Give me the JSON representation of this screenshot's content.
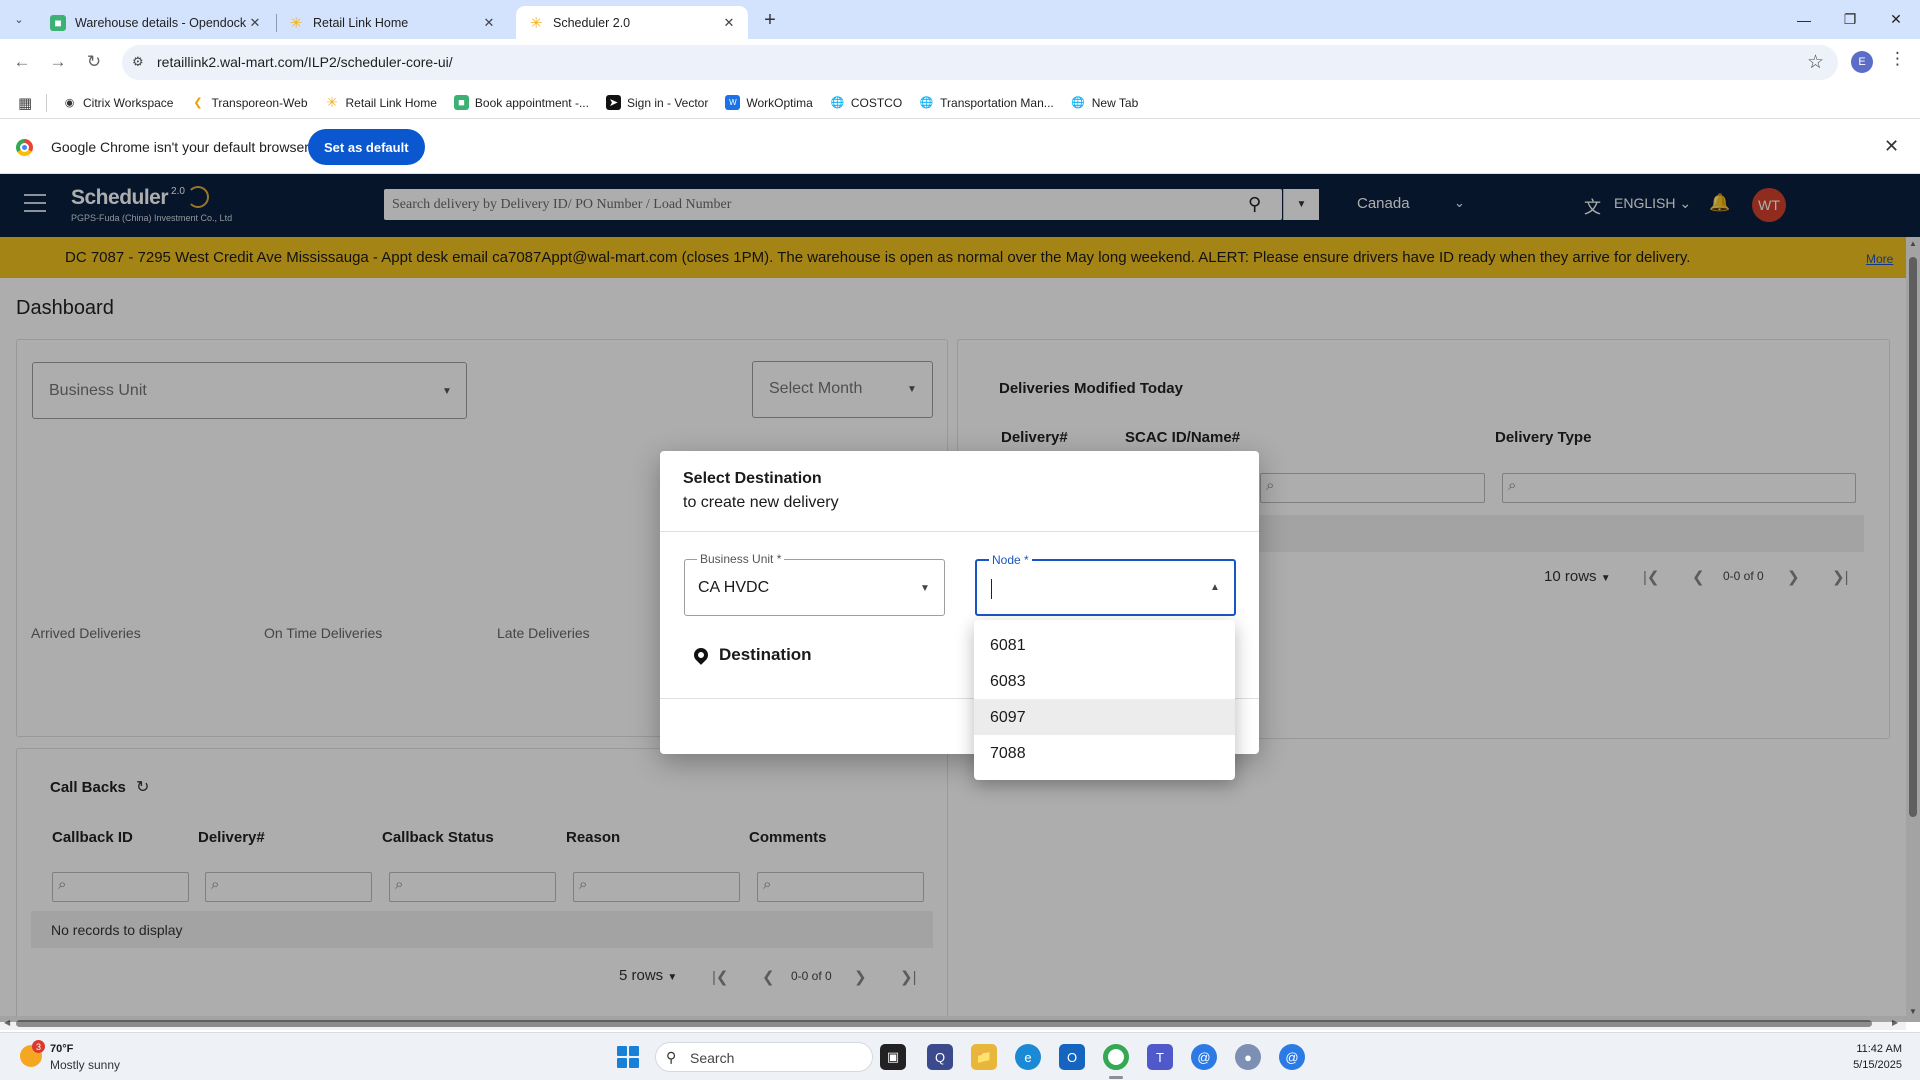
{
  "browser": {
    "tabs": [
      {
        "title": "Warehouse details - Opendock",
        "icon": "opendock-icon",
        "active": false
      },
      {
        "title": "Retail Link Home",
        "icon": "walmart-spark-icon",
        "active": false
      },
      {
        "title": "Scheduler 2.0",
        "icon": "walmart-spark-icon",
        "active": true
      }
    ],
    "url": "retaillink2.wal-mart.com/ILP2/scheduler-core-ui/",
    "profile_initial": "E",
    "bookmarks": [
      {
        "label": "Citrix Workspace",
        "icon": "citrix-icon"
      },
      {
        "label": "Transporeon-Web",
        "icon": "transporeon-icon"
      },
      {
        "label": "Retail Link Home",
        "icon": "walmart-spark-icon"
      },
      {
        "label": "Book appointment -...",
        "icon": "opendock-icon"
      },
      {
        "label": "Sign in - Vector",
        "icon": "vector-icon"
      },
      {
        "label": "WorkOptima",
        "icon": "workoptima-icon"
      },
      {
        "label": "COSTCO",
        "icon": "globe-icon"
      },
      {
        "label": "Transportation Man...",
        "icon": "globe-icon"
      },
      {
        "label": "New Tab",
        "icon": "globe-icon"
      }
    ],
    "infobar": {
      "message": "Google Chrome isn't your default browser",
      "button": "Set as default"
    }
  },
  "app": {
    "logo_title": "Scheduler",
    "logo_version": "2.0",
    "logo_subtitle": "PGPS-Fuda (China) Investment Co., Ltd",
    "search_placeholder": "Search delivery by Delivery ID/ PO Number / Load Number",
    "country": "Canada",
    "language": "ENGLISH",
    "user_initials": "WT",
    "banner_text": "DC 7087 - 7295 West Credit Ave Mississauga - Appt desk email ca7087Appt@wal-mart.com (closes 1PM). The warehouse is open as normal over the May long weekend. ALERT: Please ensure drivers have ID ready when they arrive for delivery.",
    "banner_more": "More",
    "colors": {
      "header_bg": "#0a1f3f",
      "banner_bg": "#f2c31f",
      "accent": "#1a55c5",
      "avatar": "#d5412b"
    }
  },
  "dashboard": {
    "title": "Dashboard",
    "business_unit_label": "Business Unit",
    "select_month_label": "Select Month",
    "stats": [
      "Arrived Deliveries",
      "On Time Deliveries",
      "Late Deliveries"
    ],
    "callbacks": {
      "title": "Call Backs",
      "columns": [
        "Callback ID",
        "Delivery#",
        "Callback Status",
        "Reason",
        "Comments"
      ],
      "empty": "No records to display",
      "rows_label": "5 rows",
      "count": "0-0 of 0"
    },
    "modified_today": {
      "title": "Deliveries Modified Today",
      "columns": [
        "Delivery#",
        "SCAC ID/Name#",
        "Delivery Type"
      ],
      "rows_label": "10 rows",
      "count": "0-0 of 0"
    }
  },
  "modal": {
    "title": "Select Destination",
    "subtitle": "to create new delivery",
    "business_unit_label": "Business Unit",
    "business_unit_value": "CA HVDC",
    "node_label": "Node",
    "required_mark": "*",
    "destination_label": "Destination",
    "node_options": [
      "6081",
      "6083",
      "6097",
      "7088"
    ],
    "hovered_option": "6097"
  },
  "taskbar": {
    "weather_temp": "70°F",
    "weather_desc": "Mostly sunny",
    "weather_badge": "3",
    "search_label": "Search",
    "time": "11:42 AM",
    "date": "5/15/2025"
  }
}
